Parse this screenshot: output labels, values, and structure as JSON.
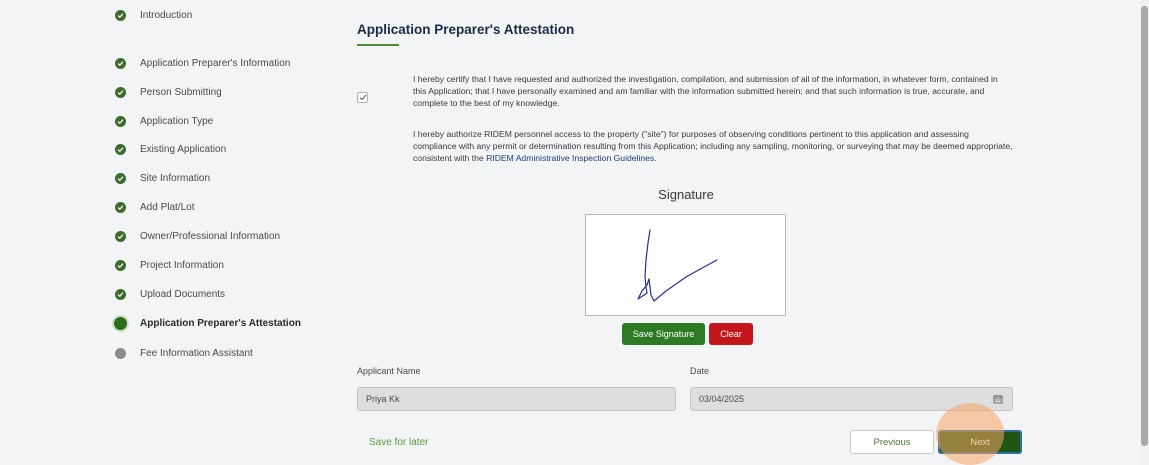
{
  "steps": [
    {
      "label": "Introduction",
      "state": "done"
    },
    {
      "label": "Application Preparer's Information",
      "state": "done"
    },
    {
      "label": "Person Submitting",
      "state": "done"
    },
    {
      "label": "Application Type",
      "state": "done"
    },
    {
      "label": "Existing Application",
      "state": "done"
    },
    {
      "label": "Site Information",
      "state": "done"
    },
    {
      "label": "Add Plat/Lot",
      "state": "done"
    },
    {
      "label": "Owner/Professional Information",
      "state": "done"
    },
    {
      "label": "Project Information",
      "state": "done"
    },
    {
      "label": "Upload Documents",
      "state": "done"
    },
    {
      "label": "Application Preparer's Attestation",
      "state": "current"
    },
    {
      "label": "Fee Information Assistant",
      "state": "pending"
    }
  ],
  "main": {
    "title": "Application Preparer's Attestation",
    "certify_checked": true,
    "certify_text": "I hereby certify that I have requested and authorized the investigation, compilation, and submission of all of the information, in whatever form, contained in this Application; that I have personally examined and am familiar with the information submitted herein; and that such information is true, accurate, and complete to the best of my knowledge.",
    "authorize_text": "I hereby authorize RIDEM personnel access to the property (\"site\") for purposes of observing conditions pertinent to this application and assessing compliance with any permit or determination resulting from this Application; including any sampling, monitoring, or surveying that may be deemed appropriate, consistent with the",
    "guidelines_link": "RIDEM Administrative Inspection Guidelines",
    "guidelines_suffix": ".",
    "signature_title": "Signature",
    "save_signature_label": "Save Signature",
    "clear_label": "Clear",
    "applicant_name_label": "Applicant Name",
    "applicant_name_value": "Priya Kk",
    "date_label": "Date",
    "date_value": "03/04/2025",
    "save_later_label": "Save for later",
    "previous_label": "Previous",
    "next_label": "Next"
  },
  "colors": {
    "step_done": "#3e6b2f",
    "step_pending": "#8a8a8a",
    "save_button": "#2d7a25",
    "clear_button": "#c5151c",
    "next_button": "#1f5415"
  }
}
